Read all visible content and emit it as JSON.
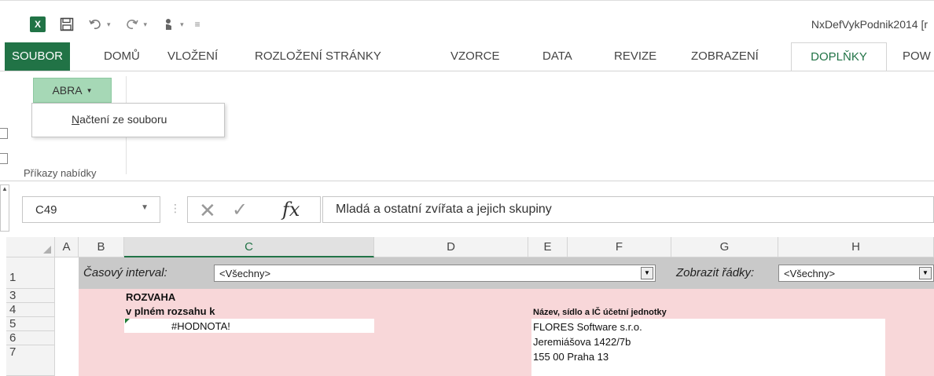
{
  "window": {
    "title": "NxDefVykPodnik2014  [r",
    "app_logo": "X"
  },
  "qat": {
    "icons": [
      "excel-logo",
      "save-icon",
      "undo-icon",
      "redo-icon",
      "touch-mode-icon",
      "customize-icon"
    ]
  },
  "tabs": [
    {
      "label": "SOUBOR"
    },
    {
      "label": "DOMŮ"
    },
    {
      "label": "VLOŽENÍ"
    },
    {
      "label": "ROZLOŽENÍ STRÁNKY"
    },
    {
      "label": "VZORCE"
    },
    {
      "label": "DATA"
    },
    {
      "label": "REVIZE"
    },
    {
      "label": "ZOBRAZENÍ"
    },
    {
      "label": "DOPLŇKY"
    },
    {
      "label": "POW"
    }
  ],
  "active_tab": "DOPLŇKY",
  "ribbon": {
    "abra_button": "ABRA",
    "menu_item": "Načtení ze souboru",
    "group_label": "Příkazy nabídky"
  },
  "formula_bar": {
    "name_box": "C49",
    "fx_label": "fx",
    "formula": "Mladá a ostatní zvířata a jejich skupiny"
  },
  "columns": [
    "A",
    "B",
    "C",
    "D",
    "E",
    "F",
    "G",
    "H"
  ],
  "selected_column": "C",
  "rows": [
    "1",
    "3",
    "4",
    "5",
    "6",
    "7"
  ],
  "sheet": {
    "interval_label": "Časový interval:",
    "interval_value": "<Všechny>",
    "rows_label": "Zobrazit řádky:",
    "rows_value": "<Všechny>",
    "rozvaha": "ROZVAHA",
    "rozsah": "v plném rozsahu k",
    "hodnota": "#HODNOTA!",
    "entity_label": "Název, sídlo a IČ účetní jednotky",
    "company": "FLORES Software  s.r.o.",
    "street": "Jeremiášova 1422/7b",
    "city": "155 00 Praha 13"
  },
  "colors": {
    "excel_green": "#217346",
    "abra_bg": "#a6d8b6",
    "pink_bg": "#f8d7d9",
    "gray_bg": "#c9c9c9"
  }
}
